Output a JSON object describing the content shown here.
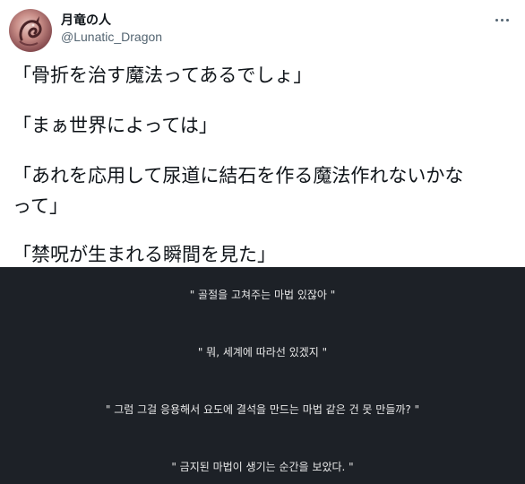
{
  "tweet": {
    "display_name": "月竜の人",
    "handle": "@Lunatic_Dragon",
    "lines": [
      "「骨折を治す魔法ってあるでしょ」",
      "「まぁ世界によっては」",
      "「あれを応用して尿道に結石を作る魔法作れないかな",
      "って」",
      "「禁呪が生まれる瞬間を見た」"
    ]
  },
  "translation": {
    "lines": [
      "\" 골절을 고쳐주는 마법 있잖아 \"",
      "\" 뭐, 세계에 따라선 있겠지 \"",
      "\" 그럼 그걸 응용해서 요도에 결석을 만드는 마법 같은 건 못 만들까? \"",
      "\" 금지된 마법이 생기는 순간을 보았다. \""
    ]
  },
  "icons": {
    "avatar": "dragon-avatar",
    "more": "more-options-icon"
  },
  "colors": {
    "tweet_background": "#ffffff",
    "text": "#0f1419",
    "handle": "#536471",
    "translation_background": "#1d2127",
    "translation_text": "#e8e8e8"
  }
}
